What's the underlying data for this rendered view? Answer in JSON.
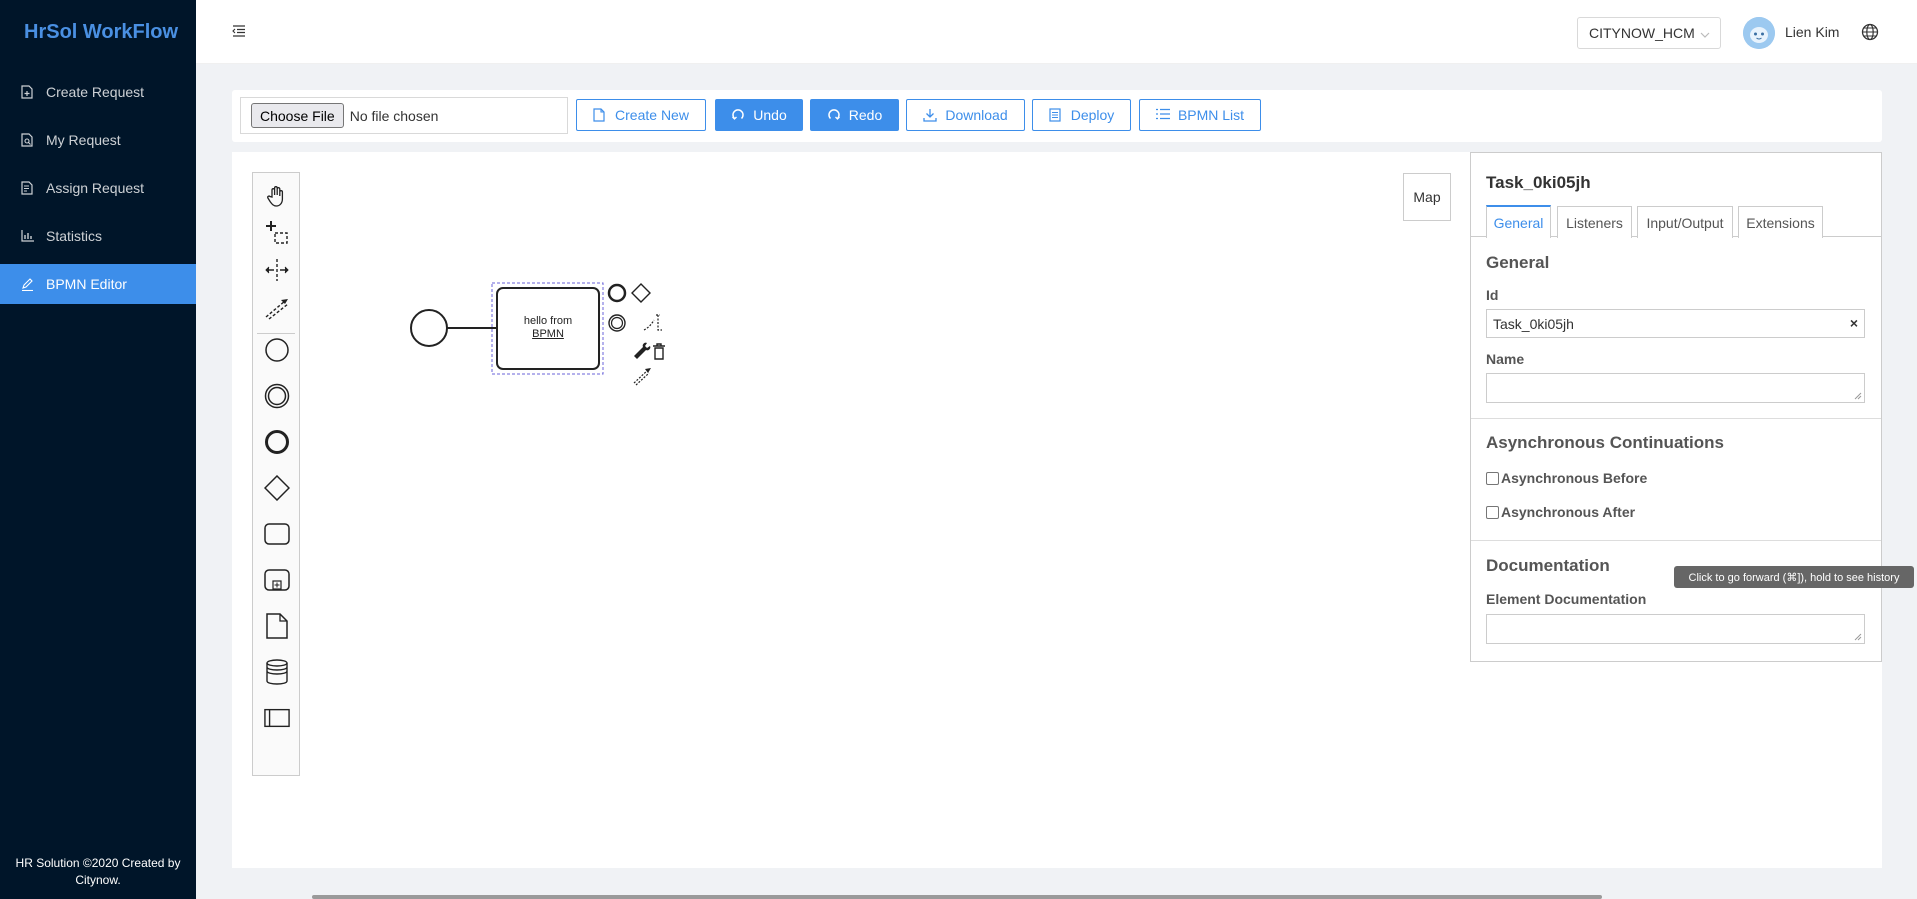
{
  "app": {
    "title": "HrSol WorkFlow",
    "footer": "HR Solution ©2020 Created by Citynow."
  },
  "sidebar": {
    "items": [
      {
        "label": "Create Request",
        "icon": "file-add-icon"
      },
      {
        "label": "My Request",
        "icon": "file-search-icon"
      },
      {
        "label": "Assign Request",
        "icon": "file-done-icon"
      },
      {
        "label": "Statistics",
        "icon": "bar-chart-icon"
      },
      {
        "label": "BPMN Editor",
        "icon": "edit-icon",
        "active": true
      }
    ]
  },
  "header": {
    "tenant": "CITYNOW_HCM",
    "username": "Lien Kim"
  },
  "toolbar": {
    "choose_file": "Choose File",
    "no_file": "No file chosen",
    "create_new": "Create New",
    "undo": "Undo",
    "redo": "Redo",
    "download": "Download",
    "deploy": "Deploy",
    "bpmn_list": "BPMN List"
  },
  "canvas": {
    "map_label": "Map",
    "task_text_line1": "hello from",
    "task_text_line2": "BPMN"
  },
  "properties": {
    "title": "Task_0ki05jh",
    "tabs": [
      "General",
      "Listeners",
      "Input/Output",
      "Extensions"
    ],
    "general_title": "General",
    "id_label": "Id",
    "id_value": "Task_0ki05jh",
    "name_label": "Name",
    "async_title": "Asynchronous Continuations",
    "async_before": "Asynchronous Before",
    "async_after": "Asynchronous After",
    "doc_title": "Documentation",
    "doc_label": "Element Documentation"
  },
  "tooltip": "Click to go forward (⌘]), hold to see history",
  "colors": {
    "primary": "#3d8eea",
    "sidebar_bg": "#001529"
  }
}
